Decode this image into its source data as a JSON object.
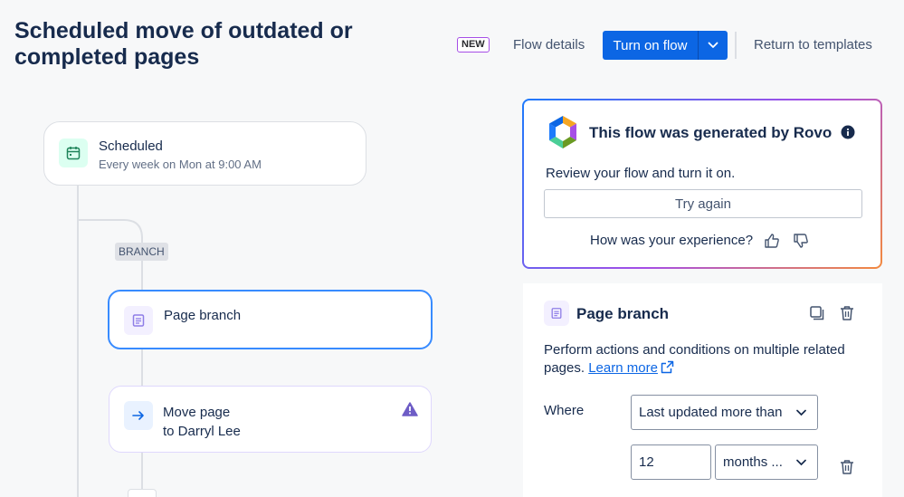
{
  "header": {
    "title": "Scheduled move of outdated or completed pages",
    "new_badge": "NEW",
    "flow_details": "Flow details",
    "turn_on": "Turn on flow",
    "return": "Return to templates"
  },
  "canvas": {
    "trigger": {
      "title": "Scheduled",
      "subtitle": "Every week on Mon at 9:00 AM"
    },
    "branch_label": "BRANCH",
    "branch_node": {
      "title": "Page branch"
    },
    "move_node": {
      "title_line1": "Move page",
      "title_line2": "to Darryl Lee"
    }
  },
  "rovo": {
    "title": "This flow was generated by Rovo",
    "text": "Review your flow and turn it on.",
    "try_again": "Try again",
    "question": "How was your experience?"
  },
  "config": {
    "title": "Page branch",
    "description": "Perform actions and conditions on multiple related pages.",
    "learn_more": "Learn more",
    "where_label": "Where",
    "condition": "Last updated more than",
    "amount": "12",
    "unit": "months ..."
  },
  "colors": {
    "primary": "#0c66e4",
    "warning": "#6e5dc6",
    "selected_border": "#388bff"
  }
}
